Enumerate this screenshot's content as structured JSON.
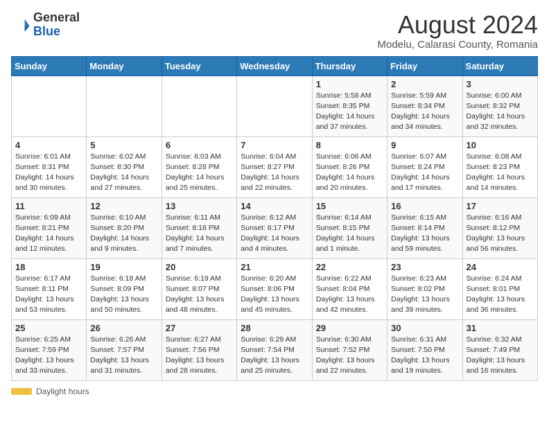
{
  "logo": {
    "general": "General",
    "blue": "Blue"
  },
  "title": "August 2024",
  "subtitle": "Modelu, Calarasi County, Romania",
  "days_of_week": [
    "Sunday",
    "Monday",
    "Tuesday",
    "Wednesday",
    "Thursday",
    "Friday",
    "Saturday"
  ],
  "footer": {
    "daylight_label": "Daylight hours"
  },
  "weeks": [
    {
      "days": [
        {
          "num": "",
          "info": ""
        },
        {
          "num": "",
          "info": ""
        },
        {
          "num": "",
          "info": ""
        },
        {
          "num": "",
          "info": ""
        },
        {
          "num": "1",
          "info": "Sunrise: 5:58 AM\nSunset: 8:35 PM\nDaylight: 14 hours\nand 37 minutes."
        },
        {
          "num": "2",
          "info": "Sunrise: 5:59 AM\nSunset: 8:34 PM\nDaylight: 14 hours\nand 34 minutes."
        },
        {
          "num": "3",
          "info": "Sunrise: 6:00 AM\nSunset: 8:32 PM\nDaylight: 14 hours\nand 32 minutes."
        }
      ]
    },
    {
      "days": [
        {
          "num": "4",
          "info": "Sunrise: 6:01 AM\nSunset: 8:31 PM\nDaylight: 14 hours\nand 30 minutes."
        },
        {
          "num": "5",
          "info": "Sunrise: 6:02 AM\nSunset: 8:30 PM\nDaylight: 14 hours\nand 27 minutes."
        },
        {
          "num": "6",
          "info": "Sunrise: 6:03 AM\nSunset: 8:28 PM\nDaylight: 14 hours\nand 25 minutes."
        },
        {
          "num": "7",
          "info": "Sunrise: 6:04 AM\nSunset: 8:27 PM\nDaylight: 14 hours\nand 22 minutes."
        },
        {
          "num": "8",
          "info": "Sunrise: 6:06 AM\nSunset: 8:26 PM\nDaylight: 14 hours\nand 20 minutes."
        },
        {
          "num": "9",
          "info": "Sunrise: 6:07 AM\nSunset: 8:24 PM\nDaylight: 14 hours\nand 17 minutes."
        },
        {
          "num": "10",
          "info": "Sunrise: 6:08 AM\nSunset: 8:23 PM\nDaylight: 14 hours\nand 14 minutes."
        }
      ]
    },
    {
      "days": [
        {
          "num": "11",
          "info": "Sunrise: 6:09 AM\nSunset: 8:21 PM\nDaylight: 14 hours\nand 12 minutes."
        },
        {
          "num": "12",
          "info": "Sunrise: 6:10 AM\nSunset: 8:20 PM\nDaylight: 14 hours\nand 9 minutes."
        },
        {
          "num": "13",
          "info": "Sunrise: 6:11 AM\nSunset: 8:18 PM\nDaylight: 14 hours\nand 7 minutes."
        },
        {
          "num": "14",
          "info": "Sunrise: 6:12 AM\nSunset: 8:17 PM\nDaylight: 14 hours\nand 4 minutes."
        },
        {
          "num": "15",
          "info": "Sunrise: 6:14 AM\nSunset: 8:15 PM\nDaylight: 14 hours\nand 1 minute."
        },
        {
          "num": "16",
          "info": "Sunrise: 6:15 AM\nSunset: 8:14 PM\nDaylight: 13 hours\nand 59 minutes."
        },
        {
          "num": "17",
          "info": "Sunrise: 6:16 AM\nSunset: 8:12 PM\nDaylight: 13 hours\nand 56 minutes."
        }
      ]
    },
    {
      "days": [
        {
          "num": "18",
          "info": "Sunrise: 6:17 AM\nSunset: 8:11 PM\nDaylight: 13 hours\nand 53 minutes."
        },
        {
          "num": "19",
          "info": "Sunrise: 6:18 AM\nSunset: 8:09 PM\nDaylight: 13 hours\nand 50 minutes."
        },
        {
          "num": "20",
          "info": "Sunrise: 6:19 AM\nSunset: 8:07 PM\nDaylight: 13 hours\nand 48 minutes."
        },
        {
          "num": "21",
          "info": "Sunrise: 6:20 AM\nSunset: 8:06 PM\nDaylight: 13 hours\nand 45 minutes."
        },
        {
          "num": "22",
          "info": "Sunrise: 6:22 AM\nSunset: 8:04 PM\nDaylight: 13 hours\nand 42 minutes."
        },
        {
          "num": "23",
          "info": "Sunrise: 6:23 AM\nSunset: 8:02 PM\nDaylight: 13 hours\nand 39 minutes."
        },
        {
          "num": "24",
          "info": "Sunrise: 6:24 AM\nSunset: 8:01 PM\nDaylight: 13 hours\nand 36 minutes."
        }
      ]
    },
    {
      "days": [
        {
          "num": "25",
          "info": "Sunrise: 6:25 AM\nSunset: 7:59 PM\nDaylight: 13 hours\nand 33 minutes."
        },
        {
          "num": "26",
          "info": "Sunrise: 6:26 AM\nSunset: 7:57 PM\nDaylight: 13 hours\nand 31 minutes."
        },
        {
          "num": "27",
          "info": "Sunrise: 6:27 AM\nSunset: 7:56 PM\nDaylight: 13 hours\nand 28 minutes."
        },
        {
          "num": "28",
          "info": "Sunrise: 6:29 AM\nSunset: 7:54 PM\nDaylight: 13 hours\nand 25 minutes."
        },
        {
          "num": "29",
          "info": "Sunrise: 6:30 AM\nSunset: 7:52 PM\nDaylight: 13 hours\nand 22 minutes."
        },
        {
          "num": "30",
          "info": "Sunrise: 6:31 AM\nSunset: 7:50 PM\nDaylight: 13 hours\nand 19 minutes."
        },
        {
          "num": "31",
          "info": "Sunrise: 6:32 AM\nSunset: 7:49 PM\nDaylight: 13 hours\nand 16 minutes."
        }
      ]
    }
  ]
}
